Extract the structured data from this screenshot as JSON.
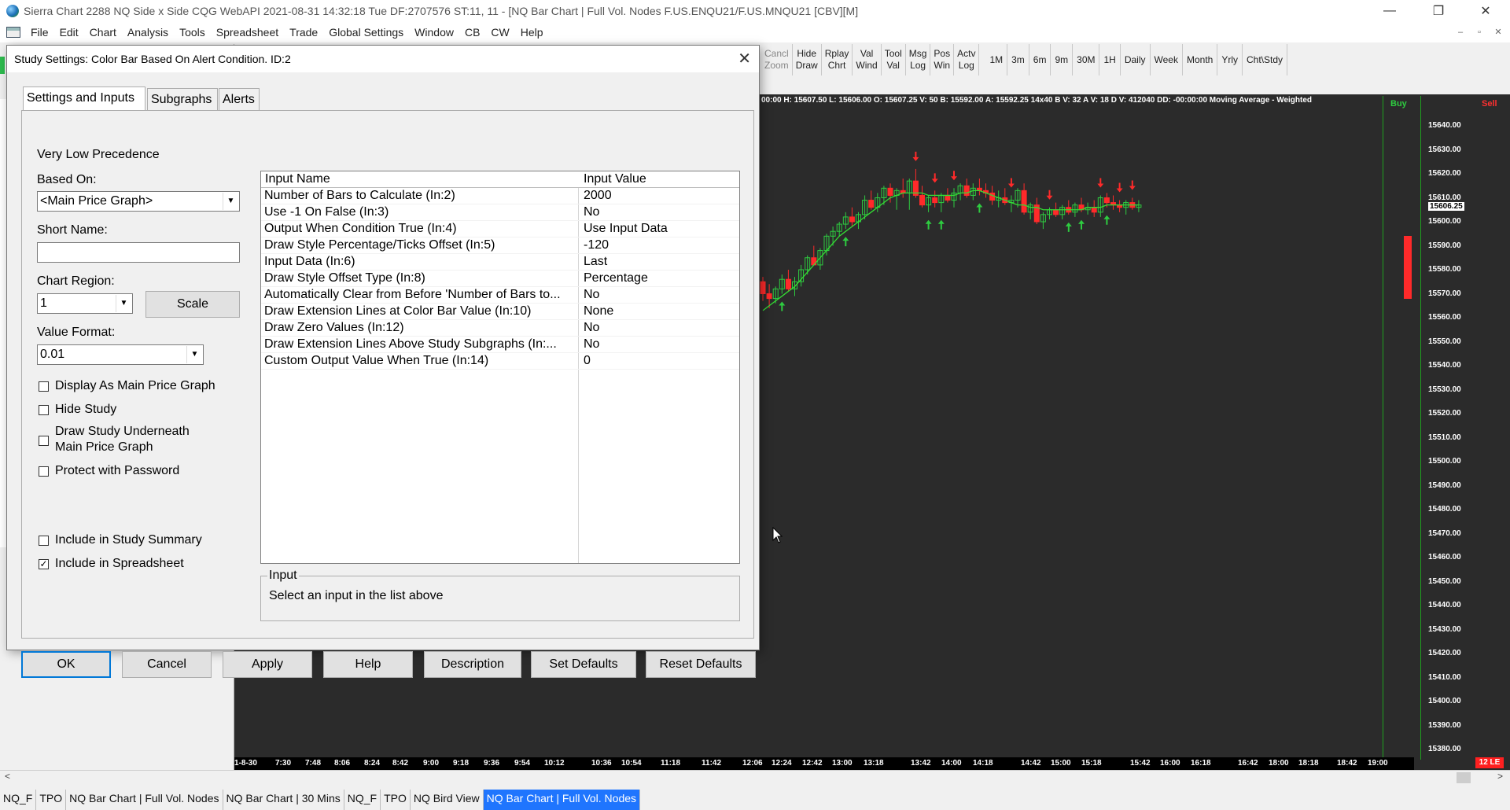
{
  "window": {
    "title": "Sierra Chart 2288 NQ Side x Side  CQG WebAPI 2021-08-31  14:32:18 Tue  DF:2707576  ST:11, 11 - [NQ Bar Chart | Full Vol. Nodes F.US.ENQU21/F.US.MNQU21 [CBV][M]",
    "controls": [
      "—",
      "❐",
      "✕"
    ]
  },
  "menu": [
    "File",
    "Edit",
    "Chart",
    "Analysis",
    "Tools",
    "Spreadsheet",
    "Trade",
    "Global Settings",
    "Window",
    "CB",
    "CW",
    "Help"
  ],
  "mdi_controls": [
    "–",
    "▫",
    "✕"
  ],
  "toolbar": {
    "multi": [
      {
        "l1": "Cancl",
        "l2": "Zoom",
        "disabled": true
      },
      {
        "l1": "Hide",
        "l2": "Draw"
      },
      {
        "l1": "Rplay",
        "l2": "Chrt"
      },
      {
        "l1": "Val",
        "l2": "Wind"
      },
      {
        "l1": "Tool",
        "l2": "Val"
      },
      {
        "l1": "Msg",
        "l2": "Log"
      },
      {
        "l1": "Pos",
        "l2": "Win"
      },
      {
        "l1": "Actv",
        "l2": "Log"
      }
    ],
    "single": [
      "1M",
      "3m",
      "6m",
      "9m",
      "30M",
      "1H",
      "Daily",
      "Week",
      "Month",
      "Yrly",
      "Cht\\Stdy"
    ]
  },
  "dialog": {
    "title": "Study Settings: Color Bar Based On Alert Condition. ID:2",
    "close": "✕",
    "tabs": [
      "Settings and Inputs",
      "Subgraphs",
      "Alerts"
    ],
    "precedence": "Very Low Precedence",
    "based_on_label": "Based On:",
    "based_on_value": "<Main Price Graph>",
    "short_name_label": "Short Name:",
    "short_name_value": "",
    "chart_region_label": "Chart Region:",
    "chart_region_value": "1",
    "scale_button": "Scale",
    "value_format_label": "Value Format:",
    "value_format_value": "0.01",
    "checkboxes": [
      {
        "label": "Display As Main Price Graph",
        "checked": false
      },
      {
        "label": "Hide Study",
        "checked": false
      },
      {
        "label": "Draw Study Underneath",
        "label2": "Main Price Graph",
        "checked": false
      },
      {
        "label": "Protect with Password",
        "checked": false
      },
      {
        "label": "Include in Study Summary",
        "checked": false
      },
      {
        "label": "Include in Spreadsheet",
        "checked": true
      }
    ],
    "grid": {
      "col_name": "Input Name",
      "col_value": "Input Value",
      "rows": [
        {
          "name": "Number of Bars to Calculate   (In:2)",
          "value": "2000"
        },
        {
          "name": "Use -1 On False   (In:3)",
          "value": "No"
        },
        {
          "name": "Output When Condition True   (In:4)",
          "value": "Use Input Data"
        },
        {
          "name": "Draw Style Percentage/Ticks Offset   (In:5)",
          "value": "-120"
        },
        {
          "name": "Input Data   (In:6)",
          "value": "Last"
        },
        {
          "name": "Draw Style Offset Type   (In:8)",
          "value": "Percentage"
        },
        {
          "name": "Automatically Clear from Before 'Number of Bars to...",
          "value": "No"
        },
        {
          "name": "Draw Extension Lines at Color Bar Value   (In:10)",
          "value": "None"
        },
        {
          "name": "Draw Zero Values   (In:12)",
          "value": "No"
        },
        {
          "name": "Draw Extension Lines Above Study Subgraphs   (In:...",
          "value": "No"
        },
        {
          "name": "Custom Output Value When True   (In:14)",
          "value": "0"
        }
      ]
    },
    "input_box_title": "Input",
    "input_box_message": "Select an input in the list above",
    "buttons": [
      "OK",
      "Cancel",
      "Apply",
      "Help",
      "Description",
      "Set Defaults",
      "Reset Defaults"
    ]
  },
  "chart": {
    "header": "00:00 H: 15607.50 L: 15606.00 O: 15607.25 V: 50 B: 15592.00  A: 15592.25  14x40 B V: 32  A V: 18 D V: 412040 DD: -00:00:00 Moving  Average -  Weighted",
    "buy_label": "Buy",
    "sell_label": "Sell",
    "current_price": "15606.25",
    "badge": "12 LE",
    "colors": {
      "background": "#2b2b2b",
      "up": "#2ecc40",
      "down": "#ff2a2a",
      "ma": "#33dd33"
    }
  },
  "chart_data": {
    "type": "candlestick",
    "price_ticks": [
      "15640.00",
      "15630.00",
      "15620.00",
      "15610.00",
      "15600.00",
      "15590.00",
      "15580.00",
      "15570.00",
      "15560.00",
      "15550.00",
      "15540.00",
      "15530.00",
      "15520.00",
      "15510.00",
      "15500.00",
      "15490.00",
      "15480.00",
      "15470.00",
      "15460.00",
      "15450.00",
      "15440.00",
      "15430.00",
      "15420.00",
      "15410.00",
      "15400.00",
      "15390.00",
      "15380.00"
    ],
    "time_ticks": [
      "1-8-30",
      "7:30",
      "7:48",
      "8:06",
      "8:24",
      "8:42",
      "9:00",
      "9:18",
      "9:36",
      "9:54",
      "10:12",
      "10:36",
      "10:54",
      "11:18",
      "11:42",
      "12:06",
      "12:24",
      "12:42",
      "13:00",
      "13:18",
      "13:42",
      "14:00",
      "14:18",
      "14:42",
      "15:00",
      "15:18",
      "15:42",
      "16:00",
      "16:18",
      "16:42",
      "18:00",
      "18:18",
      "18:42",
      "19:00"
    ],
    "ylim": [
      15380,
      15645
    ],
    "candles": [
      [
        15575,
        15577,
        15567,
        15570
      ],
      [
        15570,
        15574,
        15564,
        15568
      ],
      [
        15568,
        15573,
        15566,
        15572
      ],
      [
        15572,
        15578,
        15570,
        15576
      ],
      [
        15576,
        15580,
        15571,
        15572
      ],
      [
        15572,
        15577,
        15569,
        15575
      ],
      [
        15575,
        15582,
        15573,
        15580
      ],
      [
        15580,
        15586,
        15578,
        15585
      ],
      [
        15585,
        15590,
        15582,
        15582
      ],
      [
        15582,
        15589,
        15580,
        15588
      ],
      [
        15588,
        15595,
        15586,
        15594
      ],
      [
        15594,
        15598,
        15590,
        15596
      ],
      [
        15596,
        15600,
        15594,
        15599
      ],
      [
        15599,
        15604,
        15597,
        15602
      ],
      [
        15602,
        15606,
        15598,
        15600
      ],
      [
        15600,
        15604,
        15597,
        15603
      ],
      [
        15603,
        15611,
        15601,
        15609
      ],
      [
        15609,
        15613,
        15605,
        15606
      ],
      [
        15606,
        15612,
        15604,
        15610
      ],
      [
        15610,
        15615,
        15607,
        15614
      ],
      [
        15614,
        15616,
        15608,
        15611
      ],
      [
        15611,
        15614,
        15605,
        15613
      ],
      [
        15613,
        15618,
        15610,
        15612
      ],
      [
        15612,
        15618,
        15605,
        15617
      ],
      [
        15617,
        15622,
        15610,
        15611
      ],
      [
        15611,
        15615,
        15606,
        15607
      ],
      [
        15607,
        15611,
        15604,
        15610
      ],
      [
        15610,
        15613,
        15606,
        15608
      ],
      [
        15608,
        15612,
        15604,
        15611
      ],
      [
        15611,
        15614,
        15608,
        15609
      ],
      [
        15609,
        15614,
        15606,
        15612
      ],
      [
        15612,
        15616,
        15609,
        15615
      ],
      [
        15615,
        15618,
        15610,
        15611
      ],
      [
        15611,
        15616,
        15609,
        15614
      ],
      [
        15614,
        15618,
        15611,
        15613
      ],
      [
        15613,
        15616,
        15610,
        15612
      ],
      [
        15612,
        15615,
        15607,
        15609
      ],
      [
        15609,
        15613,
        15606,
        15610
      ],
      [
        15610,
        15614,
        15607,
        15608
      ],
      [
        15608,
        15611,
        15604,
        15609
      ],
      [
        15609,
        15614,
        15606,
        15613
      ],
      [
        15613,
        15616,
        15603,
        15604
      ],
      [
        15604,
        15608,
        15601,
        15607
      ],
      [
        15607,
        15610,
        15599,
        15600
      ],
      [
        15600,
        15604,
        15597,
        15603
      ],
      [
        15603,
        15606,
        15601,
        15605
      ],
      [
        15605,
        15608,
        15602,
        15603
      ],
      [
        15603,
        15607,
        15601,
        15606
      ],
      [
        15606,
        15609,
        15603,
        15604
      ],
      [
        15604,
        15608,
        15602,
        15607
      ],
      [
        15607,
        15610,
        15604,
        15605
      ],
      [
        15605,
        15608,
        15603,
        15606
      ],
      [
        15606,
        15609,
        15602,
        15604
      ],
      [
        15604,
        15611,
        15602,
        15610
      ],
      [
        15610,
        15612,
        15606,
        15608
      ],
      [
        15608,
        15611,
        15605,
        15607
      ],
      [
        15607,
        15609,
        15604,
        15606
      ],
      [
        15606,
        15609,
        15603,
        15608
      ],
      [
        15608,
        15610,
        15605,
        15606
      ],
      [
        15606,
        15609,
        15604,
        15607
      ]
    ],
    "ma": [
      15563,
      15565,
      15567,
      15569,
      15571,
      15573,
      15576,
      15579,
      15582,
      15585,
      15588,
      15591,
      15594,
      15596,
      15598,
      15600,
      15602,
      15604,
      15606,
      15608,
      15610,
      15611,
      15612,
      15612,
      15612,
      15612,
      15611,
      15611,
      15611,
      15611,
      15611,
      15612,
      15612,
      15613,
      15613,
      15612,
      15611,
      15610,
      15609,
      15608,
      15607,
      15607,
      15606,
      15606,
      15605,
      15605,
      15605,
      15605,
      15605,
      15605,
      15605,
      15606,
      15606,
      15606,
      15607,
      15607,
      15607,
      15607,
      15607,
      15607
    ],
    "buy_arrows": [
      3,
      13,
      26,
      28,
      34,
      48,
      50,
      54
    ],
    "sell_arrows": [
      24,
      27,
      30,
      39,
      45,
      53,
      56,
      58
    ]
  }
}
